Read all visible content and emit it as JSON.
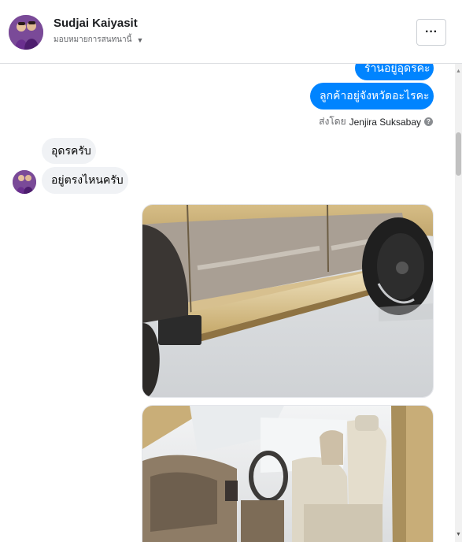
{
  "header": {
    "name": "Sudjai Kaiyasit",
    "subtitle": "มอบหมายการสนทนานี้",
    "more_icon_label": "···"
  },
  "messages": {
    "out_1": "ร้านอยู่อุดรคะ",
    "out_2": "ลูกค้าอยู่จังหวัดอะไรคะ",
    "sent_by_prefix": "ส่งโดย",
    "sent_by_name": "Jenjira Suksabay",
    "in_1": "อุดรครับ",
    "in_2": "อยู่ตรงไหนครับ"
  },
  "colors": {
    "outgoing_bubble": "#0084ff",
    "incoming_bubble": "#f0f2f5",
    "car_body": "#c8ad78"
  },
  "icons": {
    "more": "more-options-icon",
    "caret": "caret-down-icon",
    "info": "info-icon"
  }
}
